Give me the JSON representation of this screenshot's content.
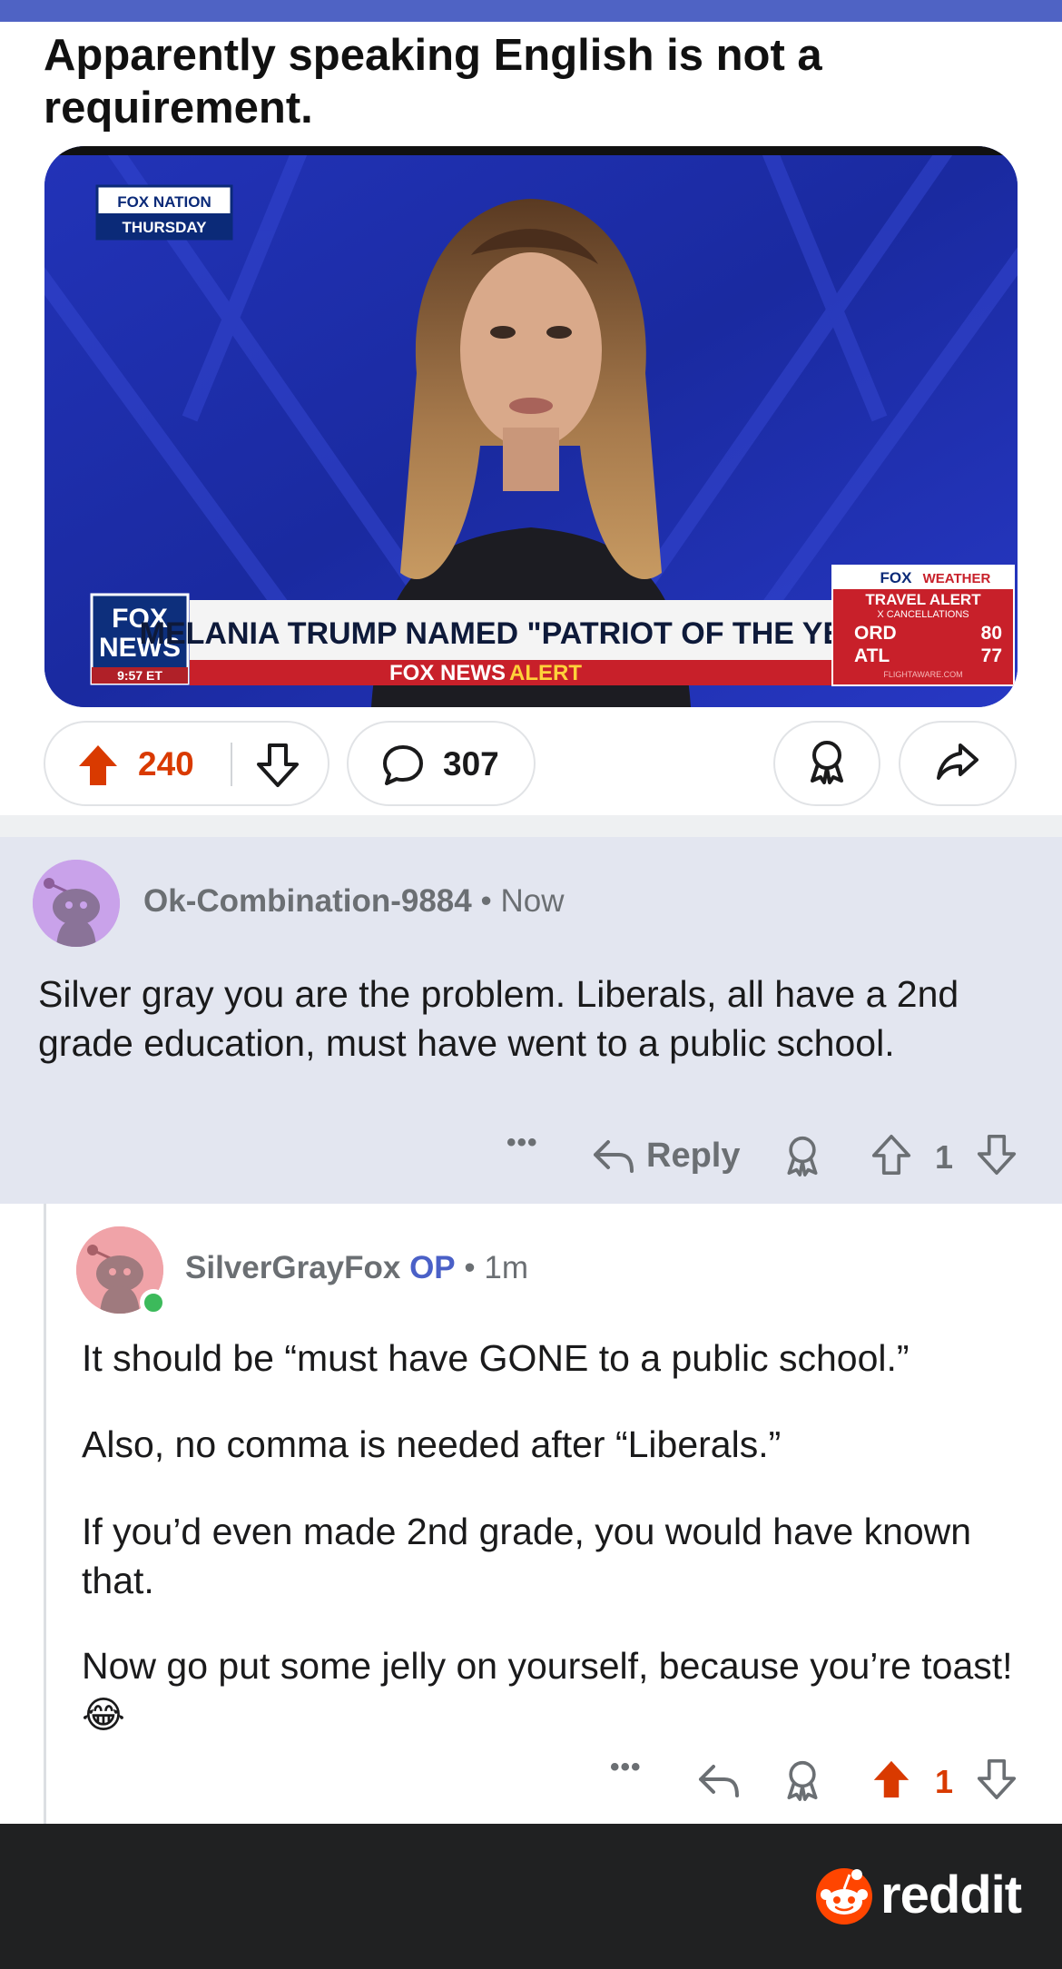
{
  "post": {
    "title": "Apparently speaking English is not a requirement.",
    "media": {
      "bug_top": "FOX NATION",
      "bug_bottom": "THURSDAY",
      "logo_line1": "FOX",
      "logo_line2": "NEWS",
      "time": "9:57 ET",
      "headline": "MELANIA TRUMP NAMED \"PATRIOT OF THE YEAR\"",
      "alert_word1": "FOX NEWS",
      "alert_word2": "ALERT",
      "weather_brand1": "FOX",
      "weather_brand2": "WEATHER",
      "weather_title": "TRAVEL ALERT",
      "weather_sub": "X CANCELLATIONS",
      "weather_rows": [
        {
          "code": "ORD",
          "value": "80"
        },
        {
          "code": "ATL",
          "value": "77"
        }
      ],
      "weather_credit": "FLIGHTAWARE.COM"
    },
    "upvotes": "240",
    "comments": "307"
  },
  "comments": [
    {
      "username": "Ok-Combination-9884",
      "separator": "•",
      "time": "Now",
      "body": "Silver gray you are the problem. Liberals, all have a 2nd grade education, must have went to a public school.",
      "more": "•••",
      "reply_label": "Reply",
      "votes": "1"
    },
    {
      "username": "SilverGrayFox",
      "op_badge": "OP",
      "separator": "•",
      "time": "1m",
      "paragraphs": [
        "It should be “must have GONE to a public school.”",
        "Also, no comma is needed after “Liberals.”",
        "If you’d even made 2nd grade, you would have known that.",
        "Now go put some jelly on yourself, because you’re toast! 😂"
      ],
      "more": "•••",
      "votes": "1"
    }
  ],
  "footer": {
    "brand": "reddit"
  },
  "colors": {
    "upvote": "#d93a00",
    "op": "#4a60c7",
    "highlight_bg": "#e3e6f0",
    "footer_bg": "#202122"
  }
}
